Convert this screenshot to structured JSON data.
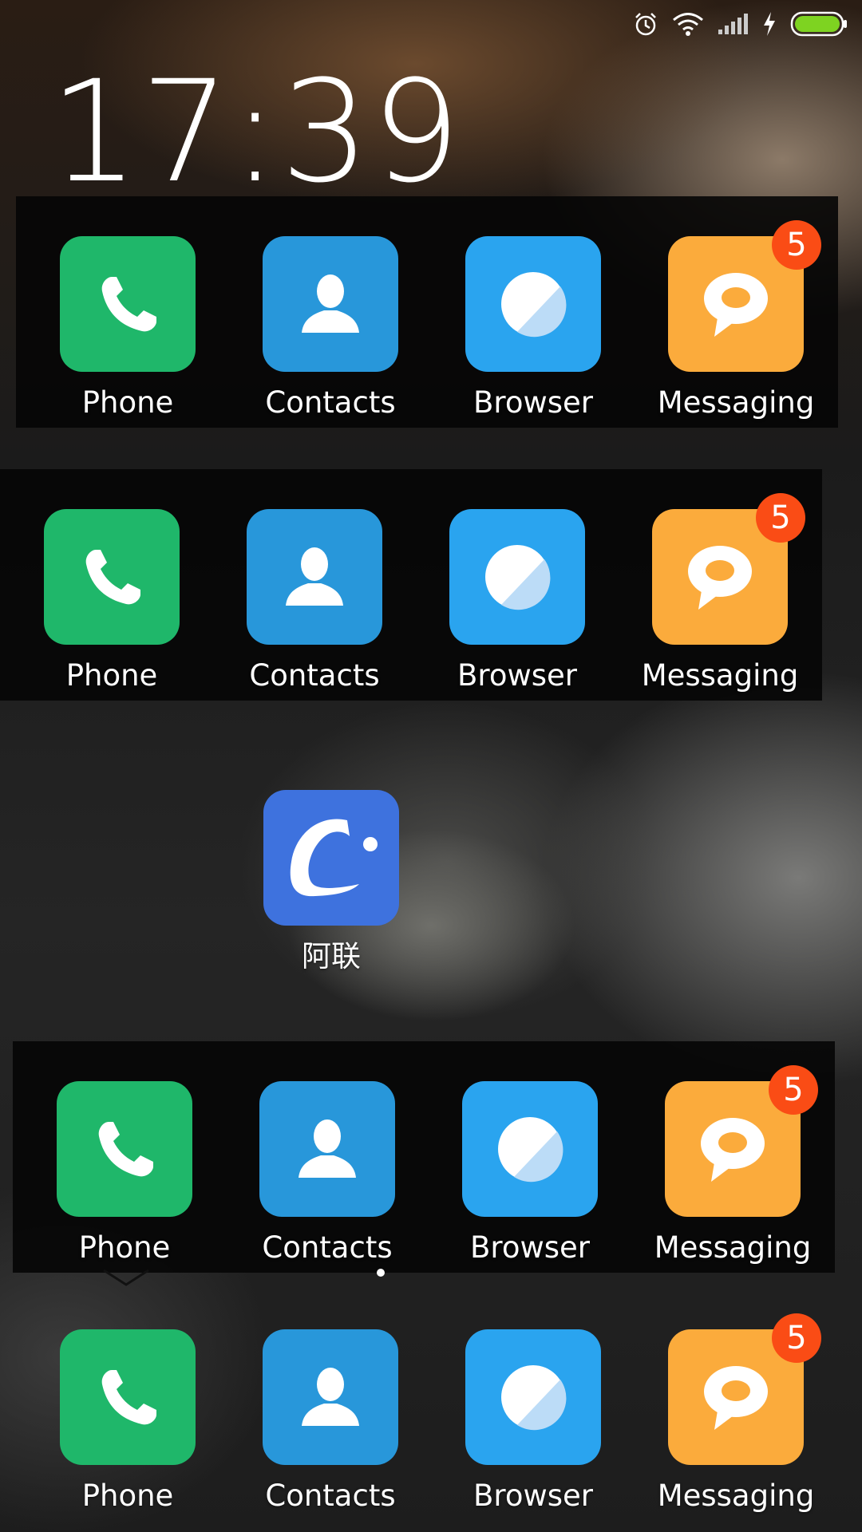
{
  "status_bar": {
    "icons": [
      "alarm-icon",
      "wifi-icon",
      "signal-icon",
      "charging-icon",
      "battery-icon"
    ],
    "battery_color": "#7ed321"
  },
  "clock": {
    "time": "17:39"
  },
  "docks": [
    {
      "apps": [
        {
          "label": "Phone",
          "icon": "phone-icon",
          "color": "#1fb76a"
        },
        {
          "label": "Contacts",
          "icon": "contact-icon",
          "color": "#2897da"
        },
        {
          "label": "Browser",
          "icon": "browser-icon",
          "color": "#2aa4ef"
        },
        {
          "label": "Messaging",
          "icon": "message-icon",
          "color": "#fbab3c",
          "badge": "5"
        }
      ]
    },
    {
      "apps": [
        {
          "label": "Phone",
          "icon": "phone-icon",
          "color": "#1fb76a"
        },
        {
          "label": "Contacts",
          "icon": "contact-icon",
          "color": "#2897da"
        },
        {
          "label": "Browser",
          "icon": "browser-icon",
          "color": "#2aa4ef"
        },
        {
          "label": "Messaging",
          "icon": "message-icon",
          "color": "#fbab3c",
          "badge": "5"
        }
      ]
    },
    {
      "apps": [
        {
          "label": "Phone",
          "icon": "phone-icon",
          "color": "#1fb76a"
        },
        {
          "label": "Contacts",
          "icon": "contact-icon",
          "color": "#2897da"
        },
        {
          "label": "Browser",
          "icon": "browser-icon",
          "color": "#2aa4ef"
        },
        {
          "label": "Messaging",
          "icon": "message-icon",
          "color": "#fbab3c",
          "badge": "5"
        }
      ]
    },
    {
      "apps": [
        {
          "label": "Phone",
          "icon": "phone-icon",
          "color": "#1fb76a"
        },
        {
          "label": "Contacts",
          "icon": "contact-icon",
          "color": "#2897da"
        },
        {
          "label": "Browser",
          "icon": "browser-icon",
          "color": "#2aa4ef"
        },
        {
          "label": "Messaging",
          "icon": "message-icon",
          "color": "#fbab3c",
          "badge": "5"
        }
      ]
    }
  ],
  "single_app": {
    "label": "阿联",
    "icon": "alian-call-icon",
    "color": "#3e72de"
  },
  "badge_color": "#fa4c15"
}
